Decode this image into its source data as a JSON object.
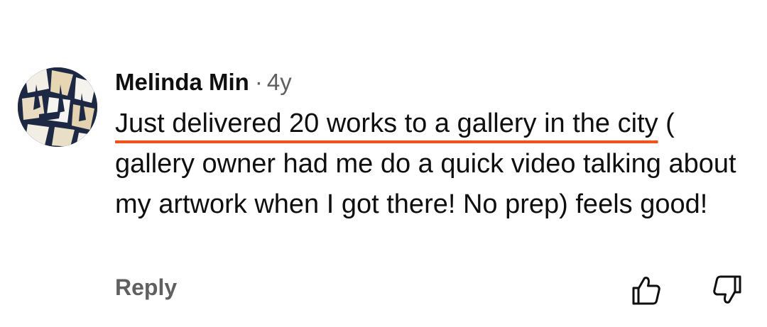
{
  "comment": {
    "author": "Melinda Min",
    "separator": "·",
    "age": "4y",
    "text_highlight": "Just delivered 20 works to a gallery in the city",
    "text_rest": " ( gallery owner had me do a quick video talking about my artwork when I got there! No prep) feels good!",
    "reply_label": "Reply",
    "like_icon": "thumbs-up-icon",
    "dislike_icon": "thumbs-down-icon",
    "highlight_color": "#ff4e0f"
  }
}
